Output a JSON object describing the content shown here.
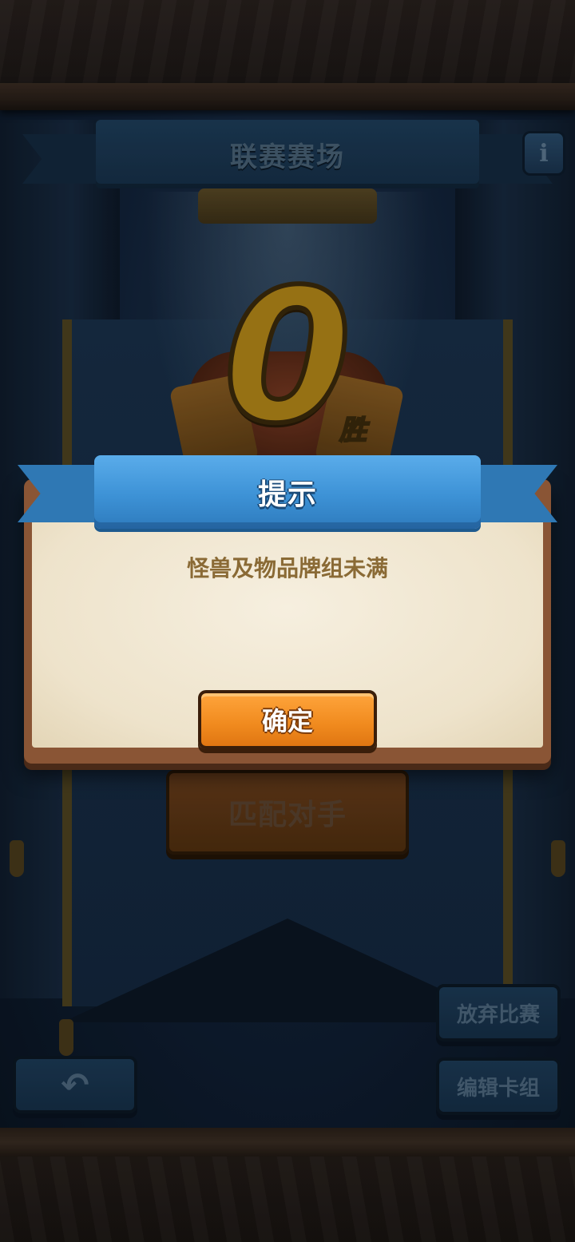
{
  "header": {
    "title": "联赛赛场",
    "info_icon": "info-icon",
    "info_glyph": "i"
  },
  "wins": {
    "count": "0",
    "suffix": "胜"
  },
  "main": {
    "match_button_label": "匹配对手"
  },
  "side_buttons": {
    "forfeit_label": "放弃比赛",
    "edit_deck_label": "编辑卡组",
    "back_icon": "back-arrow-icon",
    "back_glyph": "↶"
  },
  "dialog": {
    "title": "提示",
    "message": "怪兽及物品牌组未满",
    "confirm_label": "确定"
  },
  "colors": {
    "ribbon_blue": "#3d92d6",
    "confirm_orange": "#f08a1e",
    "paper": "#eee3cb",
    "message_text": "#8a6a35"
  }
}
